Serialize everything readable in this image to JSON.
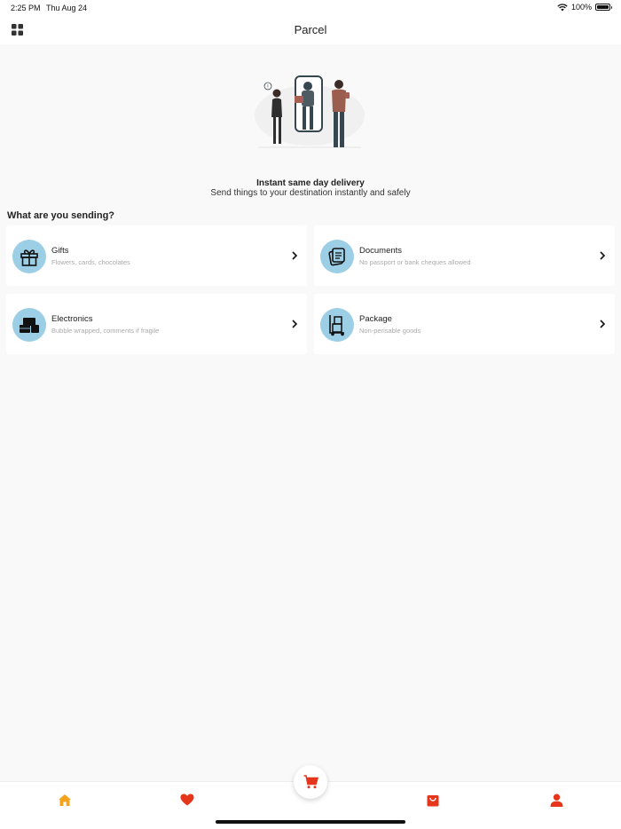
{
  "status_bar": {
    "time": "2:25 PM",
    "date": "Thu Aug 24",
    "battery": "100%",
    "battery_level": 1.0
  },
  "header": {
    "title": "Parcel"
  },
  "hero": {
    "title": "Instant same day delivery",
    "subtitle": "Send things to your destination instantly and safely"
  },
  "section": {
    "title": "What are you sending?"
  },
  "categories": [
    {
      "title": "Gifts",
      "subtitle": "Flowers, cards, chocolates",
      "icon": "gift-icon"
    },
    {
      "title": "Documents",
      "subtitle": "No passport or bank cheques allowed",
      "icon": "document-icon"
    },
    {
      "title": "Electronics",
      "subtitle": "Bubble wrapped, comments if fragile",
      "icon": "electronics-icon"
    },
    {
      "title": "Package",
      "subtitle": "Non-perisable goods",
      "icon": "package-cart-icon"
    }
  ],
  "bottom_nav": {
    "items": [
      "home-icon",
      "heart-icon",
      "cart-icon",
      "shopping-bag-icon",
      "profile-icon"
    ],
    "active": "home-icon"
  },
  "colors": {
    "accent_red": "#e5361b",
    "home_orange": "#f4a41c",
    "icon_circle": "#9ccfe5",
    "background": "#f9f9f9"
  }
}
